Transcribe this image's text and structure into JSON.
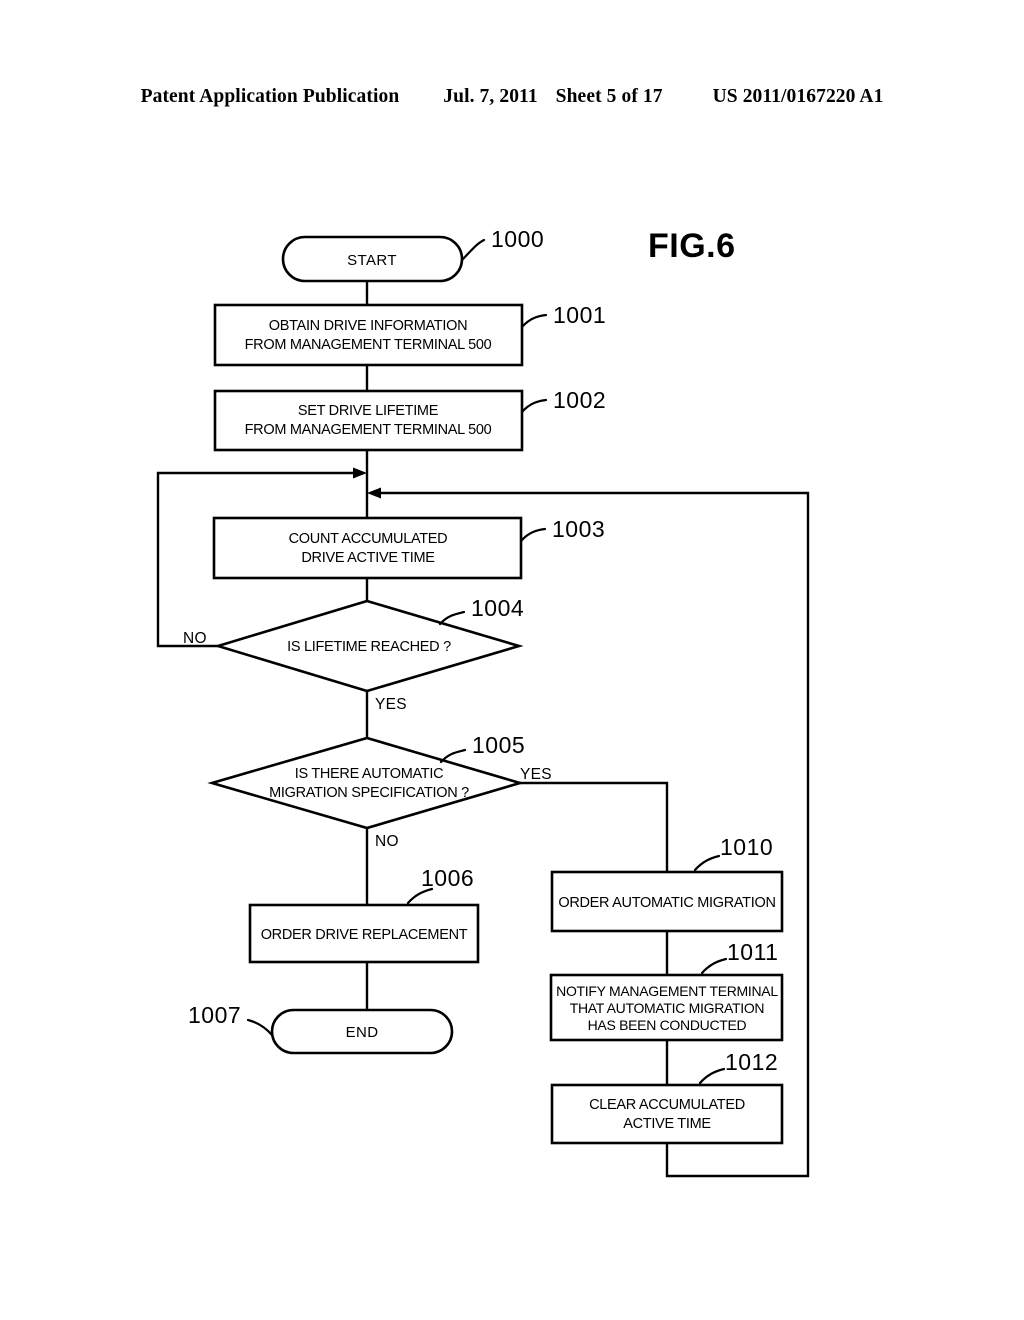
{
  "header": {
    "publication": "Patent Application Publication",
    "date": "Jul. 7, 2011",
    "sheet": "Sheet 5 of 17",
    "patent_number": "US 2011/0167220 A1"
  },
  "figure": {
    "title": "FIG.6",
    "nodes": {
      "start": {
        "ref": "1000",
        "label": "START"
      },
      "obtain_drive_info": {
        "ref": "1001",
        "line1": "OBTAIN DRIVE INFORMATION",
        "line2": "FROM MANAGEMENT TERMINAL 500"
      },
      "set_drive_lifetime": {
        "ref": "1002",
        "line1": "SET DRIVE LIFETIME",
        "line2": "FROM MANAGEMENT TERMINAL 500"
      },
      "count_active_time": {
        "ref": "1003",
        "line1": "COUNT ACCUMULATED",
        "line2": "DRIVE ACTIVE TIME"
      },
      "lifetime_reached": {
        "ref": "1004",
        "line1": "IS LIFETIME REACHED ?",
        "yes": "YES",
        "no": "NO"
      },
      "migration_spec": {
        "ref": "1005",
        "line1": "IS THERE AUTOMATIC",
        "line2": "MIGRATION SPECIFICATION ?",
        "yes": "YES",
        "no": "NO"
      },
      "order_replacement": {
        "ref": "1006",
        "line1": "ORDER DRIVE REPLACEMENT"
      },
      "end": {
        "ref": "1007",
        "label": "END"
      },
      "order_migration": {
        "ref": "1010",
        "line1": "ORDER AUTOMATIC MIGRATION"
      },
      "notify_terminal": {
        "ref": "1011",
        "line1": "NOTIFY MANAGEMENT TERMINAL",
        "line2": "THAT AUTOMATIC MIGRATION",
        "line3": "HAS BEEN CONDUCTED"
      },
      "clear_active_time": {
        "ref": "1012",
        "line1": "CLEAR ACCUMULATED",
        "line2": "ACTIVE TIME"
      }
    }
  }
}
